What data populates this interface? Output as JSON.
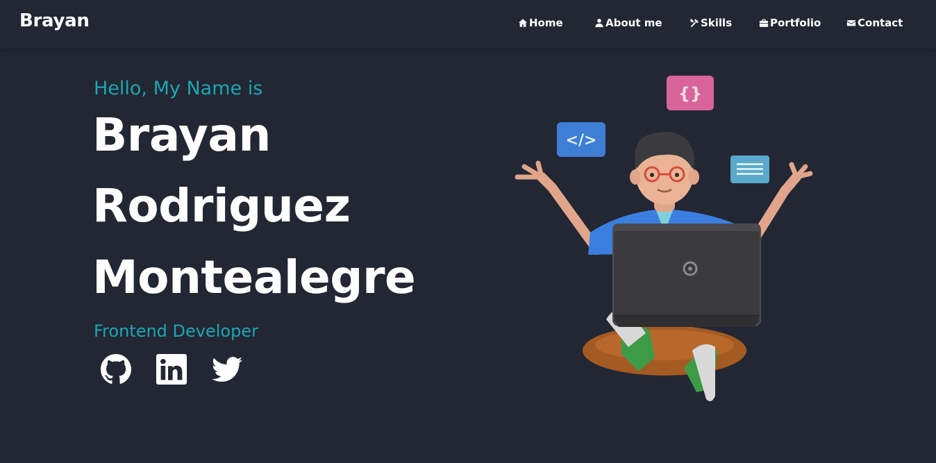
{
  "nav": {
    "brand": "Brayan",
    "links": [
      {
        "label": "Home",
        "icon": "home-icon"
      },
      {
        "label": "About me",
        "icon": "user-icon"
      },
      {
        "label": "Skills",
        "icon": "tools-icon"
      },
      {
        "label": "Portfolio",
        "icon": "briefcase-icon"
      },
      {
        "label": "Contact",
        "icon": "envelope-icon"
      }
    ]
  },
  "hero": {
    "greeting": "Hello, My Name is",
    "name_lines": [
      "Brayan",
      "Rodriguez",
      "Montealegre"
    ],
    "role": "Frontend Developer",
    "social": [
      {
        "icon": "github-icon"
      },
      {
        "icon": "linkedin-icon"
      },
      {
        "icon": "twitter-icon"
      }
    ],
    "illustration": "developer-with-laptop-illustration"
  },
  "colors": {
    "background": "#232733",
    "accent": "#1aa7b3",
    "text": "#ffffff"
  }
}
